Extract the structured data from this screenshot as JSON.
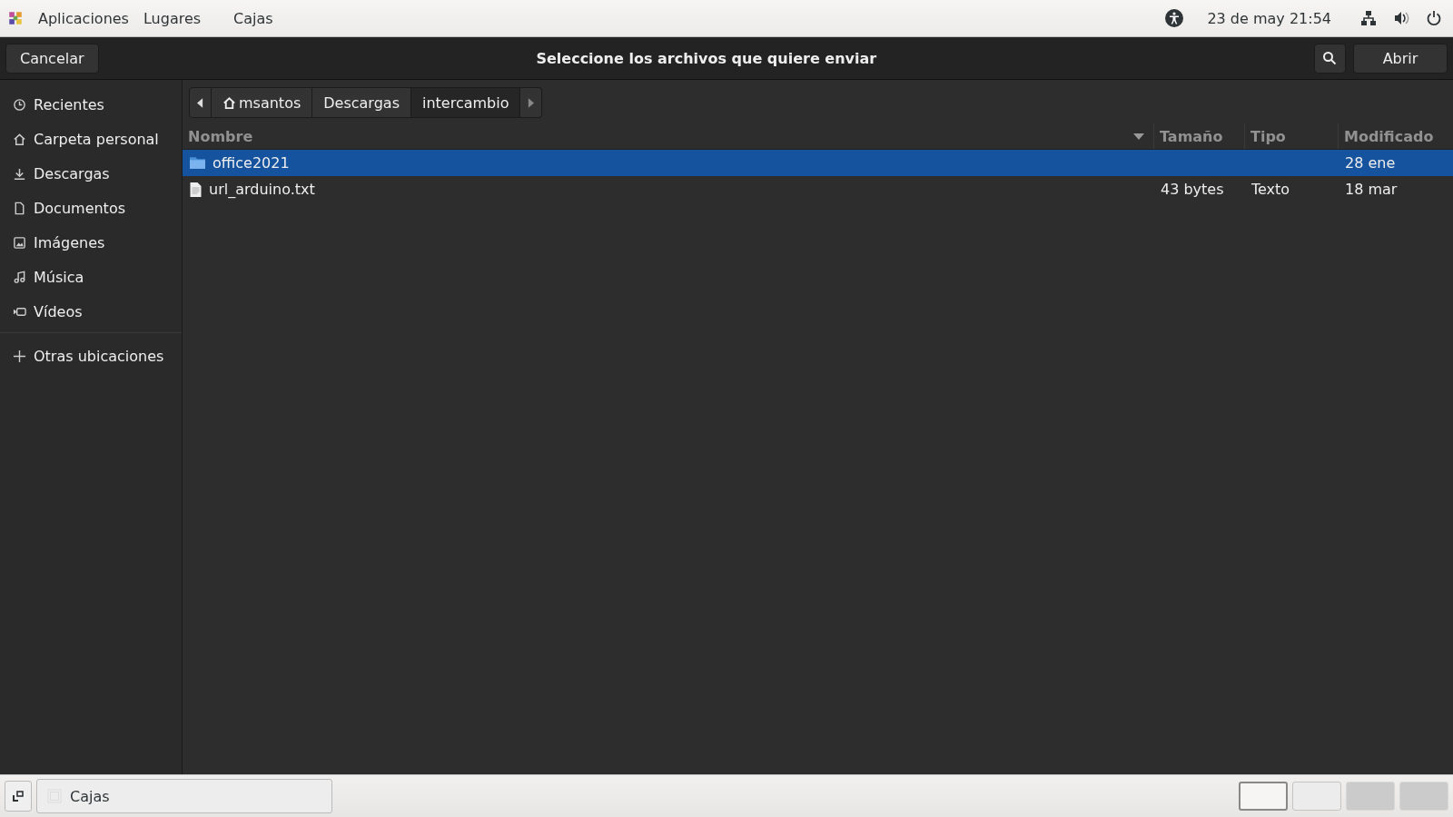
{
  "top_bar": {
    "menus": [
      "Aplicaciones",
      "Lugares",
      "Cajas"
    ],
    "clock": "23 de may  21:54"
  },
  "dialog": {
    "title": "Seleccione los archivos que quiere enviar",
    "cancel": "Cancelar",
    "open": "Abrir"
  },
  "sidebar": {
    "items": [
      {
        "label": "Recientes",
        "kind": "recent"
      },
      {
        "label": "Carpeta personal",
        "kind": "home"
      },
      {
        "label": "Descargas",
        "kind": "download"
      },
      {
        "label": "Documentos",
        "kind": "document"
      },
      {
        "label": "Imágenes",
        "kind": "image"
      },
      {
        "label": "Música",
        "kind": "music"
      },
      {
        "label": "Vídeos",
        "kind": "video"
      }
    ],
    "other": {
      "label": "Otras ubicaciones"
    }
  },
  "path_bar": [
    {
      "label": "msantos",
      "home": true,
      "selected": false
    },
    {
      "label": "Descargas",
      "home": false,
      "selected": false
    },
    {
      "label": "intercambio",
      "home": false,
      "selected": true
    }
  ],
  "table": {
    "columns": [
      "Nombre",
      "Tamaño",
      "Tipo",
      "Modificado"
    ],
    "rows": [
      {
        "kind": "folder",
        "name": "office2021",
        "size": "",
        "type": "",
        "modified": "28 ene",
        "selected": true
      },
      {
        "kind": "file",
        "name": "url_arduino.txt",
        "size": "43 bytes",
        "type": "Texto",
        "modified": "18 mar",
        "selected": false
      }
    ]
  },
  "taskbar": {
    "window": "Cajas",
    "workspaces": [
      {
        "selected": true
      },
      {
        "selected": false
      },
      {
        "selected": false
      },
      {
        "selected": false
      }
    ]
  }
}
